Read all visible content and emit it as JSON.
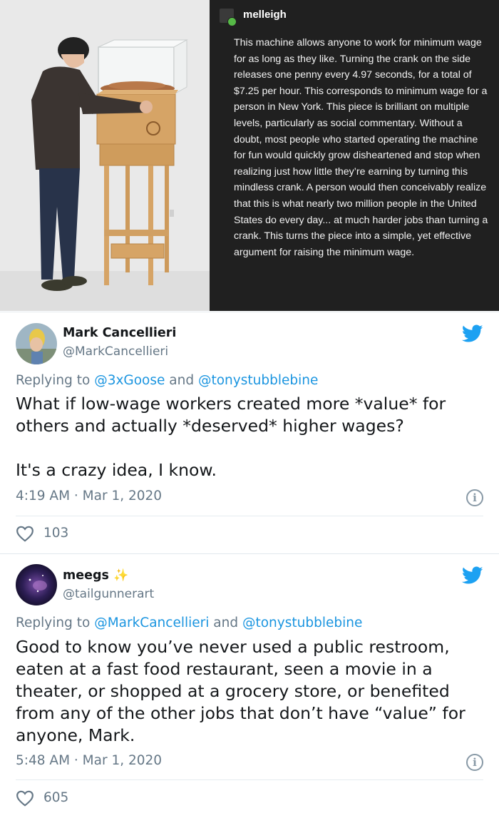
{
  "post": {
    "username": "melleigh",
    "text": "This machine allows anyone to work for minimum wage for as long as they like. Turning the crank on the side releases one penny every 4.97 seconds, for a total of $7.25 per hour. This corresponds to minimum wage for a person in New York. This piece is brilliant on multiple levels, particularly as social commentary. Without a doubt, most people who started operating the machine for fun would quickly grow disheartened and stop when realizing just how little they’re earning by turning this mindless crank. A person would then conceivably realize that this is what nearly two million people in the United States do every day... at much harder jobs than turning a crank. This turns the piece into a simple, yet effective argument for raising the minimum wage."
  },
  "tweets": [
    {
      "name": "Mark Cancellieri",
      "handle": "@MarkCancellieri",
      "reply_prefix": "Replying to ",
      "reply_to_1": "@3xGoose",
      "reply_and": " and ",
      "reply_to_2": "@tonystubblebine",
      "body_line1": "What if low-wage workers created more *value* for others and actually *deserved* higher wages?",
      "body_line2": "It's a crazy idea, I know.",
      "timestamp": "4:19 AM · Mar 1, 2020",
      "likes": "103"
    },
    {
      "name": "meegs",
      "name_emoji": "✨",
      "handle": "@tailgunnerart",
      "reply_prefix": "Replying to ",
      "reply_to_1": "@MarkCancellieri",
      "reply_and": " and ",
      "reply_to_2": "@tonystubblebine",
      "body": "Good to know you’ve never used a public restroom, eaten at a fast food restaurant, seen a movie in a theater, or shopped at a grocery store, or benefited from any of the other jobs that don’t have “value” for anyone, Mark.",
      "timestamp": "5:48 AM · Mar 1, 2020",
      "likes": "605"
    }
  ],
  "icons": {
    "bird": "twitter-bird-icon",
    "info": "info-icon",
    "like": "heart-icon"
  },
  "info_glyph": "i",
  "colors": {
    "twitter_blue": "#1da1f2",
    "link_blue": "#1b95e0",
    "muted": "#657786",
    "post_bg": "#202020"
  }
}
